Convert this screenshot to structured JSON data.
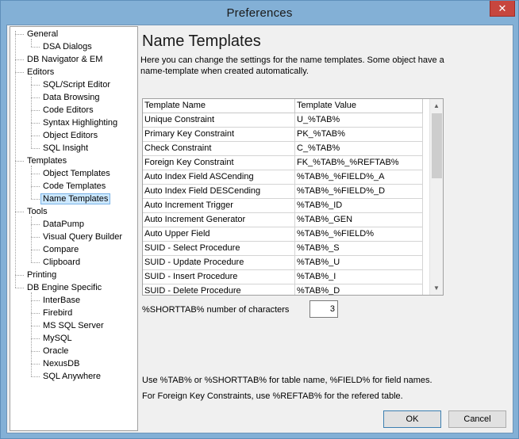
{
  "window": {
    "title": "Preferences",
    "close_glyph": "✕"
  },
  "tree": {
    "items": [
      {
        "label": "General",
        "depth": 0,
        "expandable": true
      },
      {
        "label": "DSA Dialogs",
        "depth": 1
      },
      {
        "label": "DB Navigator & EM",
        "depth": 0
      },
      {
        "label": "Editors",
        "depth": 0,
        "expandable": true
      },
      {
        "label": "SQL/Script Editor",
        "depth": 1
      },
      {
        "label": "Data Browsing",
        "depth": 1
      },
      {
        "label": "Code Editors",
        "depth": 1
      },
      {
        "label": "Syntax Highlighting",
        "depth": 1
      },
      {
        "label": "Object Editors",
        "depth": 1
      },
      {
        "label": "SQL Insight",
        "depth": 1
      },
      {
        "label": "Templates",
        "depth": 0,
        "expandable": true
      },
      {
        "label": "Object Templates",
        "depth": 1
      },
      {
        "label": "Code Templates",
        "depth": 1
      },
      {
        "label": "Name Templates",
        "depth": 1,
        "selected": true
      },
      {
        "label": "Tools",
        "depth": 0,
        "expandable": true
      },
      {
        "label": "DataPump",
        "depth": 1
      },
      {
        "label": "Visual Query Builder",
        "depth": 1
      },
      {
        "label": "Compare",
        "depth": 1
      },
      {
        "label": "Clipboard",
        "depth": 1
      },
      {
        "label": "Printing",
        "depth": 0
      },
      {
        "label": "DB Engine Specific",
        "depth": 0,
        "expandable": true
      },
      {
        "label": "InterBase",
        "depth": 1
      },
      {
        "label": "Firebird",
        "depth": 1
      },
      {
        "label": "MS SQL Server",
        "depth": 1
      },
      {
        "label": "MySQL",
        "depth": 1
      },
      {
        "label": "Oracle",
        "depth": 1
      },
      {
        "label": "NexusDB",
        "depth": 1
      },
      {
        "label": "SQL Anywhere",
        "depth": 1
      }
    ]
  },
  "page": {
    "heading": "Name Templates",
    "description": "Here you can change the settings for the name templates. Some object have a name-template when created automatically."
  },
  "grid": {
    "columns": [
      "Template Name",
      "Template Value"
    ],
    "rows": [
      [
        "Unique Constraint",
        "U_%TAB%"
      ],
      [
        "Primary Key Constraint",
        "PK_%TAB%"
      ],
      [
        "Check Constraint",
        "C_%TAB%"
      ],
      [
        "Foreign Key Constraint",
        "FK_%TAB%_%REFTAB%"
      ],
      [
        "Auto Index Field ASCending",
        "%TAB%_%FIELD%_A"
      ],
      [
        "Auto Index Field DESCending",
        "%TAB%_%FIELD%_D"
      ],
      [
        "Auto Increment Trigger",
        "%TAB%_ID"
      ],
      [
        "Auto Increment Generator",
        "%TAB%_GEN"
      ],
      [
        "Auto Upper Field",
        "%TAB%_%FIELD%"
      ],
      [
        "SUID - Select Procedure",
        "%TAB%_S"
      ],
      [
        "SUID - Update Procedure",
        "%TAB%_U"
      ],
      [
        "SUID - Insert Procedure",
        "%TAB%_I"
      ],
      [
        "SUID - Delete Procedure",
        "%TAB%_D"
      ]
    ],
    "scroll_up_glyph": "▲",
    "scroll_down_glyph": "▼"
  },
  "shorttab": {
    "label": "%SHORTTAB% number of characters",
    "value": "3"
  },
  "hints": {
    "line1": "Use %TAB% or %SHORTTAB% for table name, %FIELD% for field names.",
    "line2": "For Foreign Key Constraints, use %REFTAB% for the refered table."
  },
  "buttons": {
    "ok": "OK",
    "cancel": "Cancel"
  }
}
